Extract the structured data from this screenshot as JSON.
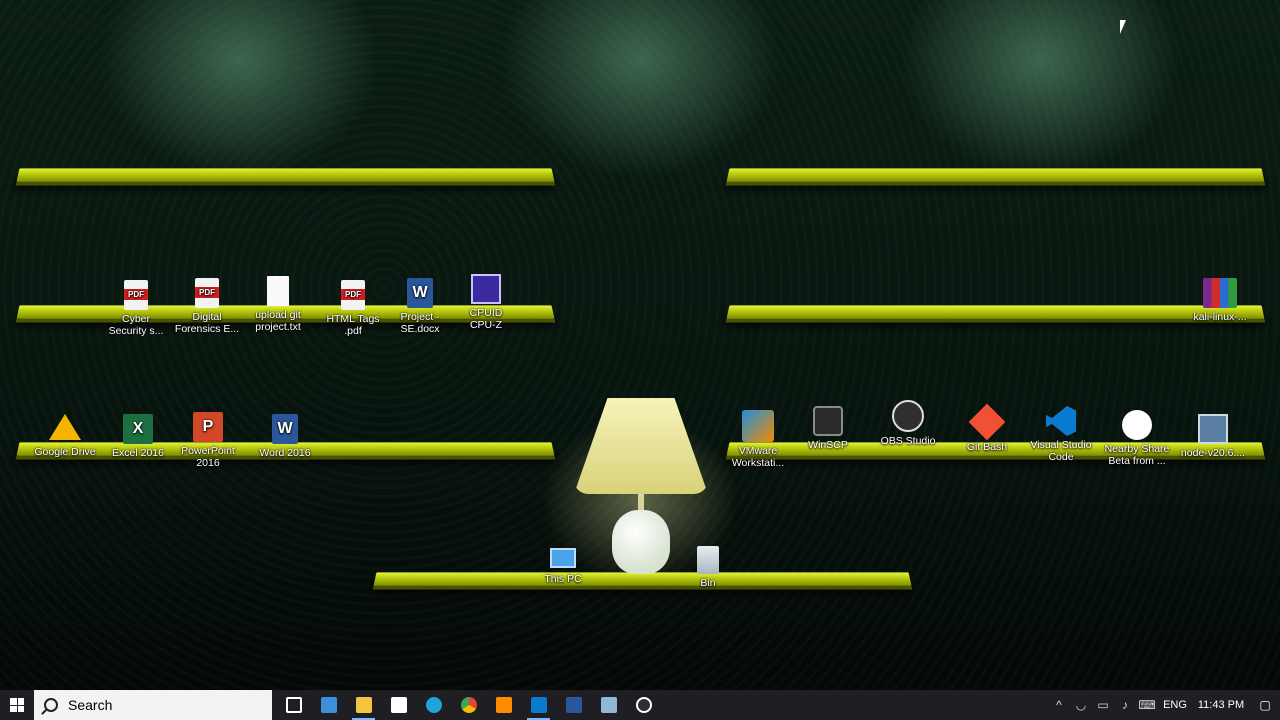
{
  "shelf_icons": {
    "row1": [
      {
        "label": "Cyber\nSecurity s...",
        "icon": "pdf-icon"
      },
      {
        "label": "Digital\nForensics E...",
        "icon": "pdf-icon"
      },
      {
        "label": "upload git\nproject.txt",
        "icon": "text-file-icon"
      },
      {
        "label": "HTML Tags\n.pdf",
        "icon": "pdf-icon"
      },
      {
        "label": "Project -\nSE.docx",
        "icon": "word-doc-icon"
      },
      {
        "label": "CPUID\nCPU-Z",
        "icon": "cpuz-icon"
      }
    ],
    "row1_right": [
      {
        "label": "kali-linux-...",
        "icon": "winrar-archive-icon"
      }
    ],
    "row2": [
      {
        "label": "Google Drive",
        "icon": "google-drive-icon"
      },
      {
        "label": "Excel 2016",
        "icon": "excel-icon"
      },
      {
        "label": "PowerPoint\n2016",
        "icon": "powerpoint-icon"
      },
      {
        "label": "Word 2016",
        "icon": "word-icon"
      }
    ],
    "row2_right": [
      {
        "label": "VMware\nWorkstati...",
        "icon": "vmware-icon"
      },
      {
        "label": "WinSCP",
        "icon": "winscp-icon"
      },
      {
        "label": "OBS Studio",
        "icon": "obs-icon"
      },
      {
        "label": "Git Bash",
        "icon": "git-bash-icon"
      },
      {
        "label": "Visual Studio\nCode",
        "icon": "vscode-icon"
      },
      {
        "label": "Nearby Share\nBeta from ...",
        "icon": "nearby-share-icon"
      },
      {
        "label": "node-v20.6....",
        "icon": "node-installer-icon"
      }
    ],
    "bottom": [
      {
        "label": "This PC",
        "icon": "this-pc-icon"
      },
      {
        "label": "Bin",
        "icon": "recycle-bin-icon"
      }
    ]
  },
  "taskbar": {
    "search_placeholder": "Search",
    "apps": [
      {
        "name": "task-view",
        "color": "#ffffff"
      },
      {
        "name": "desktop",
        "color": "#3c8fd8"
      },
      {
        "name": "file-explorer",
        "color": "#f4c542"
      },
      {
        "name": "store",
        "color": "#ffffff"
      },
      {
        "name": "edge",
        "color": "#1fa3d9"
      },
      {
        "name": "chrome",
        "color": "#ea4335"
      },
      {
        "name": "office",
        "color": "#ff8a00"
      },
      {
        "name": "vscode",
        "color": "#0b7ad1"
      },
      {
        "name": "word",
        "color": "#2b579a"
      },
      {
        "name": "notepad",
        "color": "#8fb8d8"
      },
      {
        "name": "obs",
        "color": "#ffffff"
      }
    ],
    "language": "ENG",
    "time": "11:43 PM"
  },
  "colors": {
    "shelf": "#c8d71a",
    "taskbar": "#1f1f23"
  }
}
